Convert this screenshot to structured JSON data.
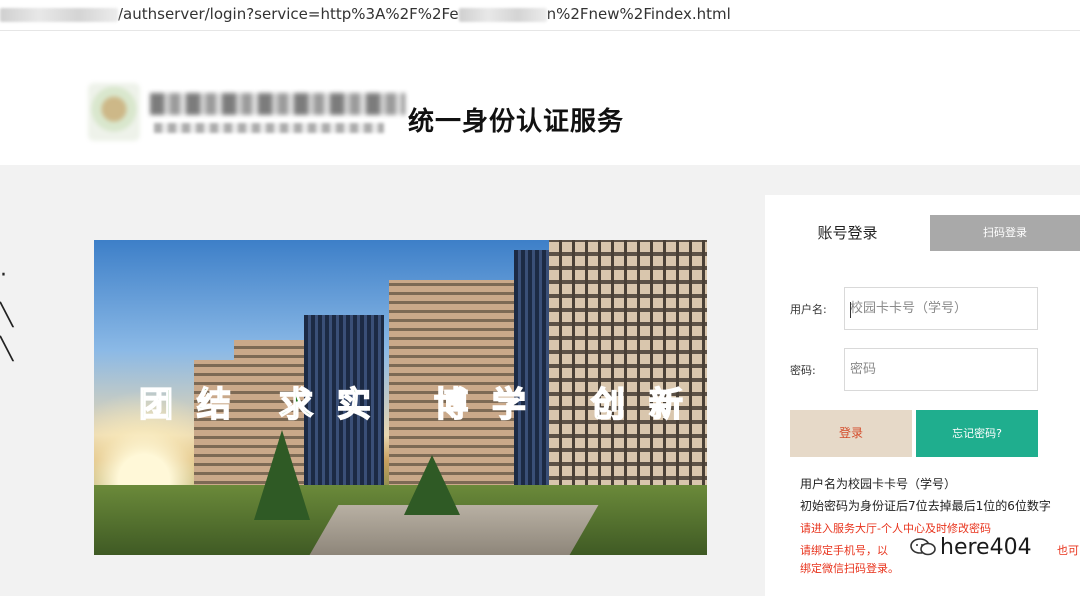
{
  "address_bar": {
    "url_visible_1": "/authserver/login?service=http%3A%2F%2Fe",
    "url_visible_2": "n%2Fnew%2Findex.html"
  },
  "header": {
    "site_title": "统一身份认证服务"
  },
  "banner": {
    "slogan": [
      "团 结",
      "求 实",
      "博 学",
      "创 新"
    ]
  },
  "login": {
    "tab_account": "账号登录",
    "tab_qr": "扫码登录",
    "username_label": "用户名:",
    "username_placeholder": "校园卡卡号（学号）",
    "password_label": "密码:",
    "password_placeholder": "密码",
    "login_button": "登录",
    "forgot_button": "忘记密码?",
    "notes": [
      "用户名为校园卡卡号（学号）",
      "初始密码为身份证后7位去掉最后1位的6位数字",
      "请进入服务大厅-个人中心及时修改密码",
      "请绑定手机号，以",
      "绑定微信扫码登录。"
    ],
    "note_trailing": "也可"
  },
  "watermark": {
    "text": "here404"
  },
  "colors": {
    "login_button_bg": "#e6d9c8",
    "login_button_text": "#d44b2a",
    "forgot_button_bg": "#1fae8e",
    "qr_tab_bg": "#a9a9a9",
    "note_red": "#e8331c",
    "slogan_green": "#1c7a1c"
  }
}
